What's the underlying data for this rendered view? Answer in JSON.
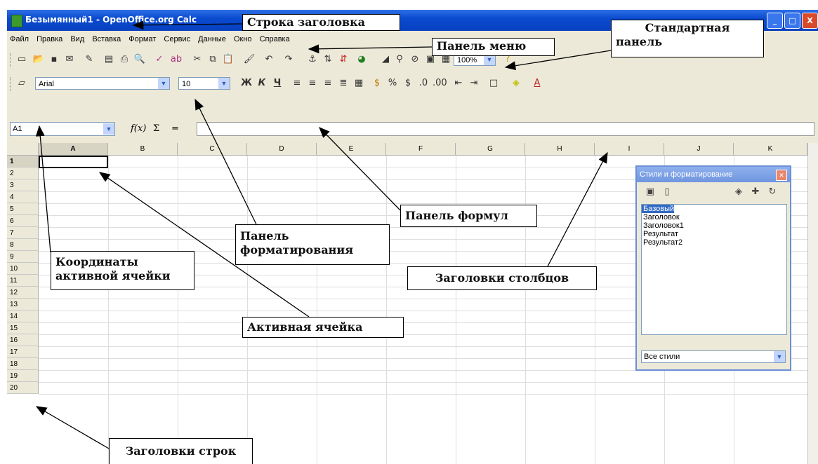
{
  "window": {
    "title": "Безымянный1 - OpenOffice.org Calc",
    "buttons": {
      "minimize": "_",
      "maximize": "□",
      "close": "X"
    }
  },
  "menu": [
    "Файл",
    "Правка",
    "Вид",
    "Вставка",
    "Формат",
    "Сервис",
    "Данные",
    "Окно",
    "Справка"
  ],
  "format_bar": {
    "font": "Arial",
    "size": "10",
    "bold": "Ж",
    "italic": "К",
    "underline": "Ч"
  },
  "standard_bar": {
    "zoom": "100%"
  },
  "formula_bar": {
    "cell_ref": "A1",
    "func_label": "f(x)",
    "sum_label": "Σ",
    "equals_label": "="
  },
  "columns": [
    "A",
    "B",
    "C",
    "D",
    "E",
    "F",
    "G",
    "H",
    "I",
    "J",
    "K"
  ],
  "rows": [
    "1",
    "2",
    "3",
    "4",
    "5",
    "6",
    "7",
    "8",
    "9",
    "10",
    "11",
    "12",
    "13",
    "14",
    "15",
    "16",
    "17",
    "18",
    "19",
    "20"
  ],
  "styles_panel": {
    "title": "Стили и форматирование",
    "items": [
      "Базовый",
      "Заголовок",
      "Заголовок1",
      "Результат",
      "Результат2"
    ],
    "filter": "Все стили"
  },
  "annotations": {
    "title_bar": "Строка заголовка",
    "menu_bar": "Панель меню",
    "standard_panel_1": "Стандартная",
    "standard_panel_2": "панель",
    "formula_panel": "Панель формул",
    "format_panel_1": "Панель",
    "format_panel_2": "форматирования",
    "cell_coords_1": "Координаты",
    "cell_coords_2": "активной ячейки",
    "column_headers": "Заголовки столбцов",
    "active_cell": "Активная ячейка",
    "row_headers": "Заголовки строк"
  }
}
